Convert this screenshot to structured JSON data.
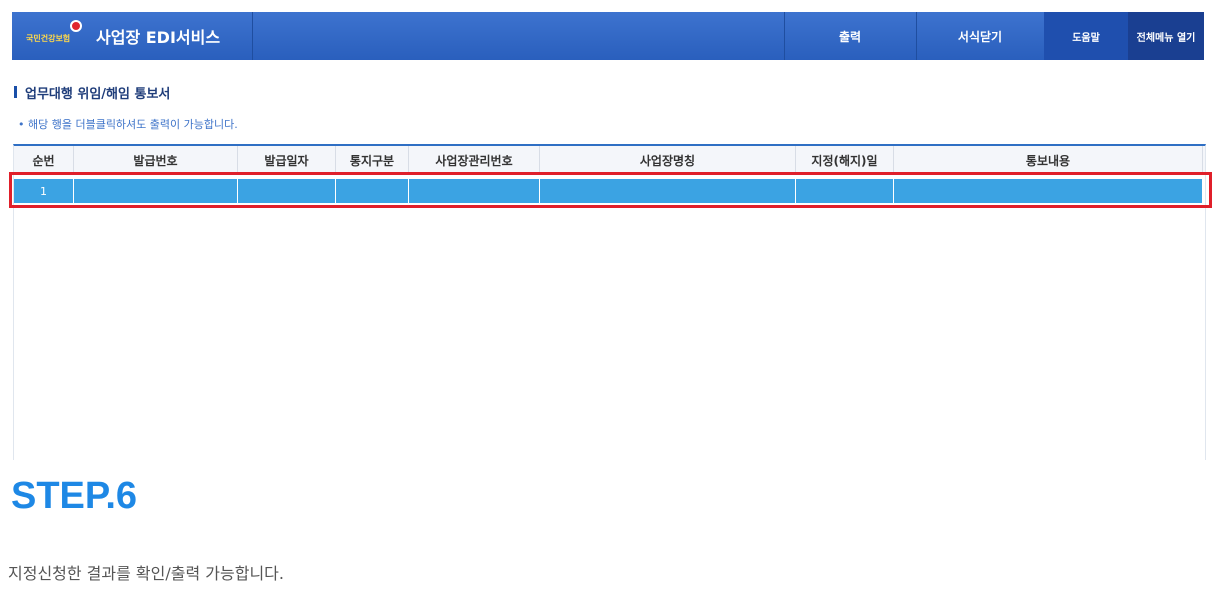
{
  "header": {
    "logo_text": "국민건강보험",
    "title": "사업장 EDI서비스",
    "buttons": {
      "print": "출력",
      "close_form": "서식닫기",
      "help": "도움말",
      "open_all_menu": "전체메뉴 열기"
    }
  },
  "section": {
    "title": "업무대행 위임/해임 통보서",
    "notice": "• 해당 행을 더블클릭하셔도 출력이 가능합니다."
  },
  "table": {
    "columns": [
      "순번",
      "발급번호",
      "발급일자",
      "통지구분",
      "사업장관리번호",
      "사업장명칭",
      "지정(해지)일",
      "통보내용"
    ],
    "rows": [
      {
        "seq": "1",
        "issue_no": "",
        "issue_date": "",
        "notice_type": "",
        "workplace_mgmt_no": "",
        "workplace_name": "",
        "designation_date": "",
        "content": ""
      }
    ],
    "selected_row_color": "#3ba3e3",
    "highlight_color": "#e01f2a"
  },
  "step": {
    "title": "STEP.6",
    "description": "지정신청한 결과를 확인/출력 가능합니다."
  },
  "colors": {
    "header_bg": "#2f66c6",
    "accent": "#1e88e5"
  }
}
